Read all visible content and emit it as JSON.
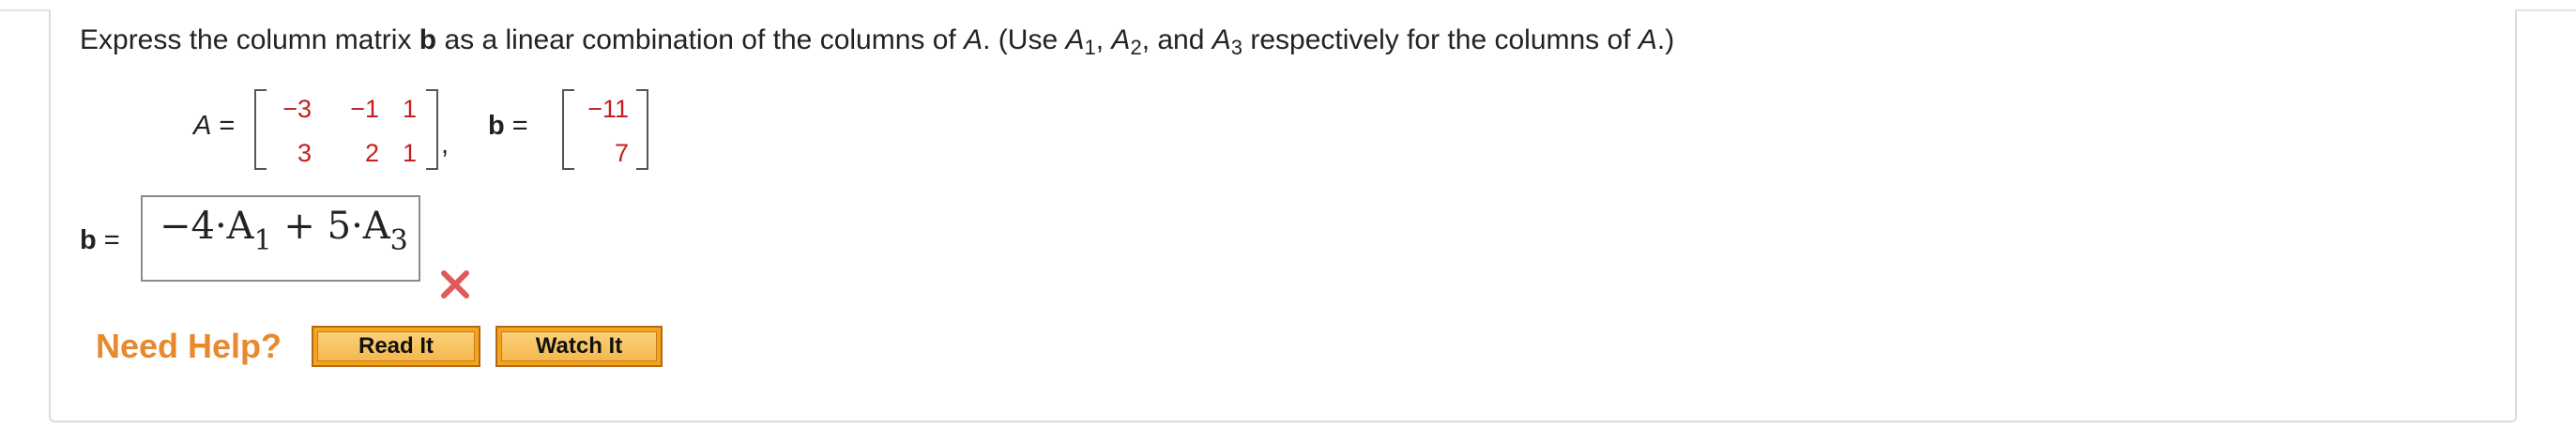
{
  "prompt": {
    "text_before_b": "Express the column matrix ",
    "b_symbol": "b",
    "text_mid": " as a linear combination of the columns of ",
    "A_symbol": "A",
    "text_use": ". (Use ",
    "A1": "A",
    "sub1": "1",
    "comma1": ", ",
    "A2": "A",
    "sub2": "2",
    "text_and": ", and ",
    "A3": "A",
    "sub3": "3",
    "text_end": " respectively for the columns of ",
    "A_symbol2": "A",
    "text_close": ".)"
  },
  "matrix_A": {
    "label": "A",
    "equals": "=",
    "rows": [
      [
        "−3",
        "−1",
        "1"
      ],
      [
        "3",
        "2",
        "1"
      ]
    ],
    "trailing": ","
  },
  "vector_b": {
    "label": "b",
    "equals": "=",
    "rows": [
      "−11",
      "7"
    ]
  },
  "answer": {
    "label": "b",
    "equals": "=",
    "expression_part1": "−4·A",
    "sub_a": "1",
    "expression_part2": " + 5·A",
    "sub_b": "3",
    "status": "incorrect",
    "status_color": "#e05a5a"
  },
  "help": {
    "title": "Need Help?",
    "buttons": [
      "Read It",
      "Watch It"
    ],
    "title_color": "#e8892e",
    "button_color": "#f6a21a"
  }
}
